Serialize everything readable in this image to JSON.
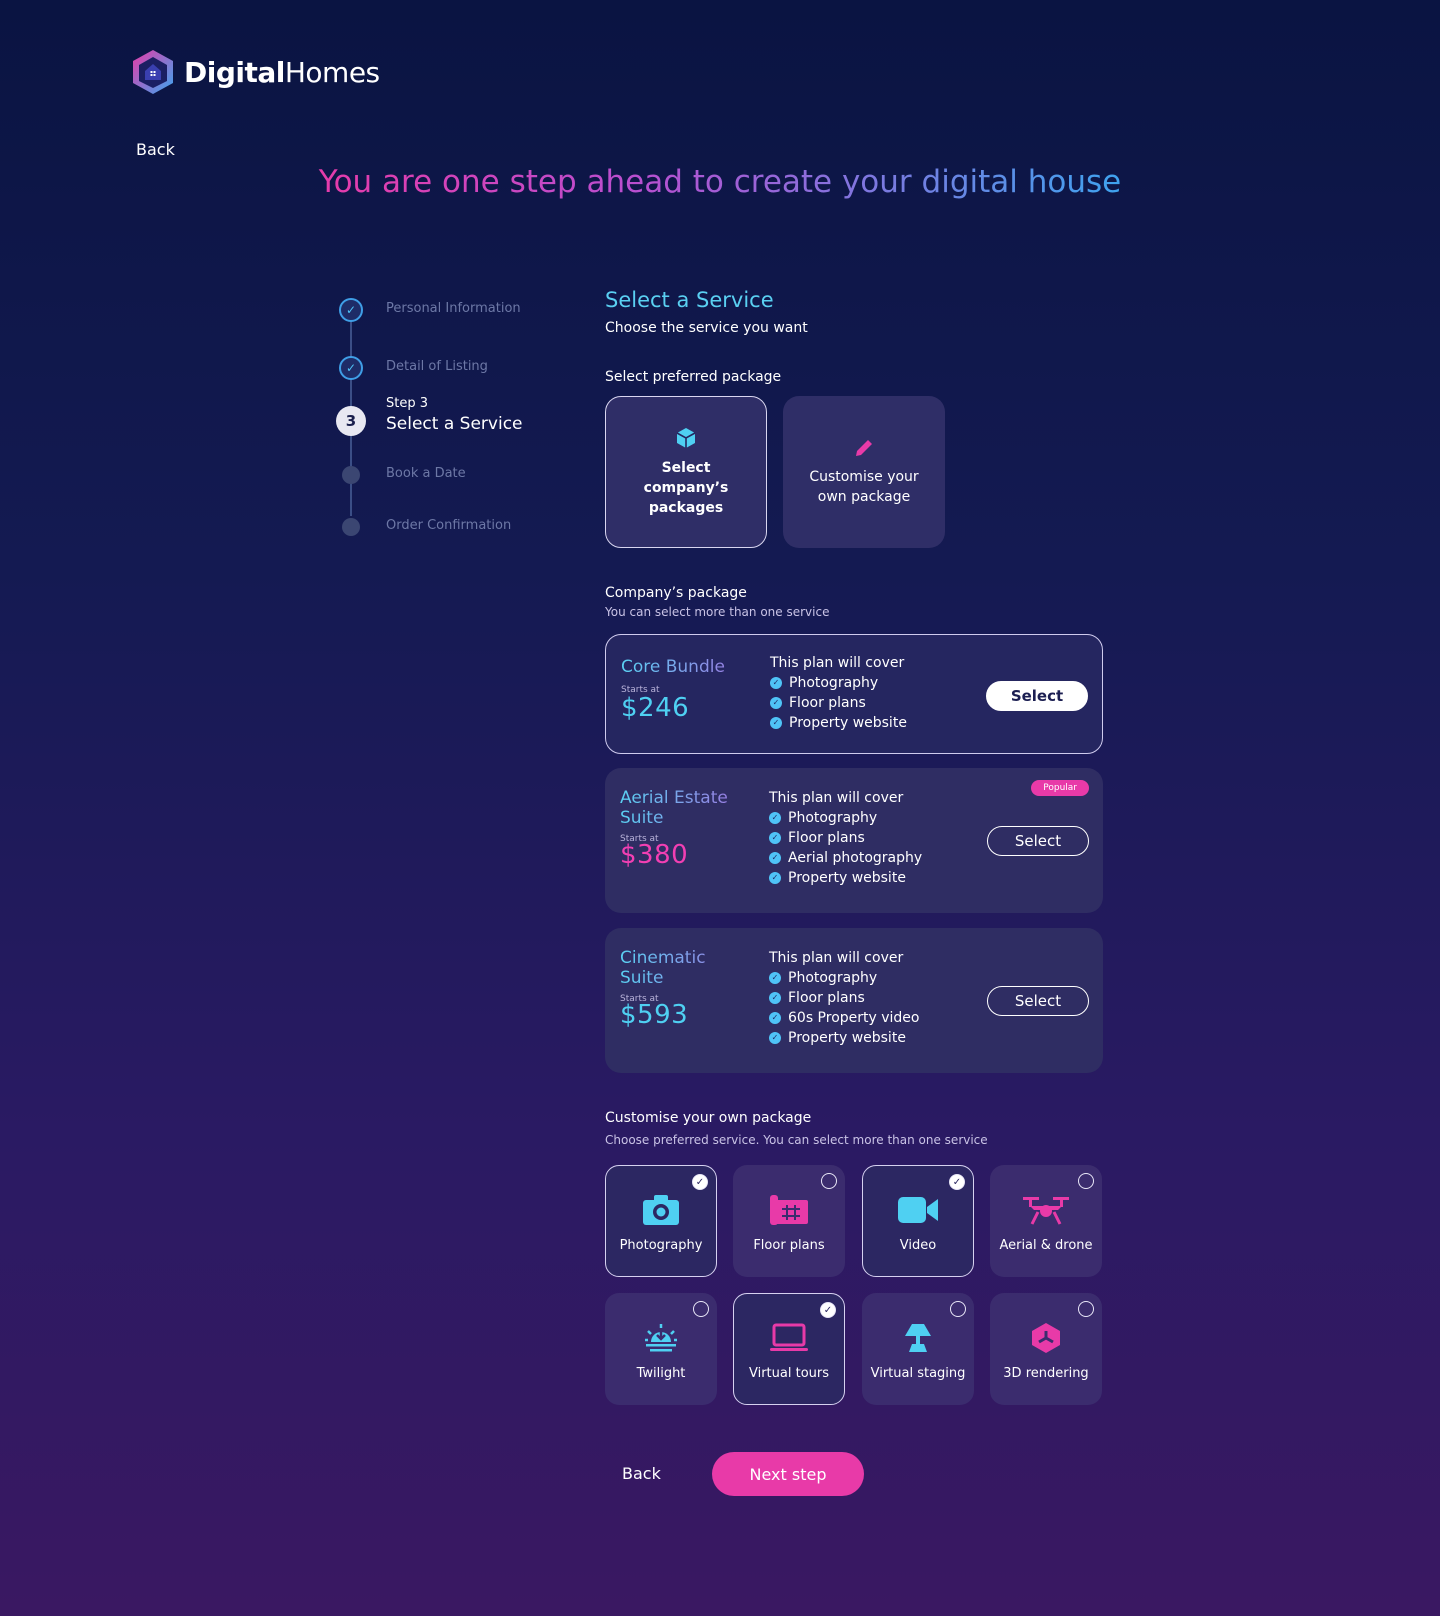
{
  "brand": {
    "bold": "Digital",
    "light": "Homes"
  },
  "nav": {
    "back_label": "Back"
  },
  "headline": "You are one step ahead to create your digital house",
  "stepper": {
    "steps": [
      {
        "label": "Personal Information",
        "state": "done"
      },
      {
        "label": "Detail of Listing",
        "state": "done"
      },
      {
        "number": "3",
        "small": "Step 3",
        "label": "Select a Service",
        "state": "current"
      },
      {
        "label": "Book a Date",
        "state": "todo"
      },
      {
        "label": "Order Confirmation",
        "state": "todo"
      }
    ]
  },
  "section": {
    "title": "Select a Service",
    "subtitle": "Choose the service you want"
  },
  "package_type": {
    "label": "Select preferred package",
    "options": [
      {
        "label": "Select company’s packages",
        "icon": "box-icon",
        "selected": true
      },
      {
        "label": "Customise your own package",
        "icon": "pencil-icon",
        "selected": false
      }
    ]
  },
  "company": {
    "label": "Company’s package",
    "sublabel": "You can select more than one service",
    "cover_heading": "This plan will cover",
    "starts_label": "Starts at",
    "select_label": "Select",
    "popular_label": "Popular",
    "plans": [
      {
        "name": "Core Bundle",
        "price": "$246",
        "features": [
          "Photography",
          "Floor plans",
          "Property website"
        ],
        "selected": true
      },
      {
        "name": "Aerial Estate Suite",
        "price": "$380",
        "features": [
          "Photography",
          "Floor plans",
          "Aerial photography",
          "Property website"
        ],
        "popular": true
      },
      {
        "name": "Cinematic Suite",
        "price": "$593",
        "features": [
          "Photography",
          "Floor plans",
          "60s Property video",
          "Property website"
        ]
      }
    ]
  },
  "custom": {
    "label": "Customise your own package",
    "sublabel": "Choose preferred service. You can select more than one service",
    "services": [
      {
        "label": "Photography",
        "icon": "camera-icon",
        "checked": true
      },
      {
        "label": "Floor plans",
        "icon": "floor-plan-icon",
        "checked": false
      },
      {
        "label": "Video",
        "icon": "video-camera-icon",
        "checked": true
      },
      {
        "label": "Aerial & drone",
        "icon": "drone-icon",
        "checked": false
      },
      {
        "label": "Twilight",
        "icon": "sunset-icon",
        "checked": false
      },
      {
        "label": "Virtual tours",
        "icon": "laptop-icon",
        "checked": true
      },
      {
        "label": "Virtual staging",
        "icon": "lamp-icon",
        "checked": false
      },
      {
        "label": "3D rendering",
        "icon": "cube-icon",
        "checked": false
      }
    ]
  },
  "footer": {
    "back_label": "Back",
    "next_label": "Next step"
  },
  "colors": {
    "accent_pink": "#e83aa8",
    "accent_cyan": "#4fd0f2"
  }
}
